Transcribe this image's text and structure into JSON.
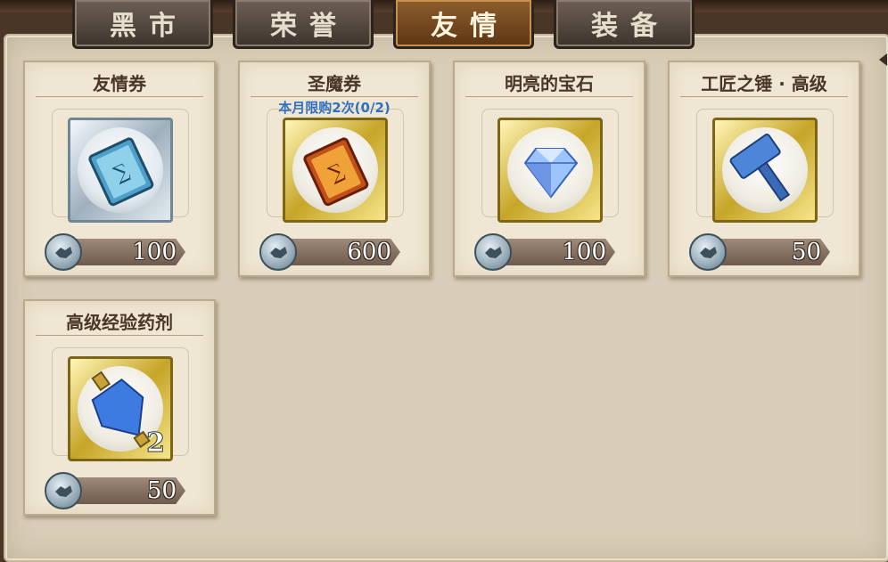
{
  "tabs": [
    {
      "label": "黑市",
      "active": false
    },
    {
      "label": "荣誉",
      "active": false
    },
    {
      "label": "友情",
      "active": true
    },
    {
      "label": "装备",
      "active": false
    }
  ],
  "items": [
    {
      "name": "友情券",
      "price": "100",
      "limit": "",
      "quantity": "",
      "icon": "ticket-silver-icon",
      "frame": "silver"
    },
    {
      "name": "圣魔券",
      "price": "600",
      "limit": "本月限购2次(0/2)",
      "quantity": "",
      "icon": "ticket-gold-icon",
      "frame": "gold"
    },
    {
      "name": "明亮的宝石",
      "price": "100",
      "limit": "",
      "quantity": "",
      "icon": "gem-icon",
      "frame": "gold"
    },
    {
      "name": "工匠之锤 · 高级",
      "price": "50",
      "limit": "",
      "quantity": "",
      "icon": "hammer-icon",
      "frame": "gold"
    },
    {
      "name": "高级经验药剂",
      "price": "50",
      "limit": "",
      "quantity": "2",
      "icon": "potion-icon",
      "frame": "gold"
    }
  ],
  "currency_icon": "friendship-coin-icon",
  "colors": {
    "active_tab": "#8e5e2d",
    "limit_text": "#2a6fc4",
    "card_bg": "#efe6d3"
  }
}
